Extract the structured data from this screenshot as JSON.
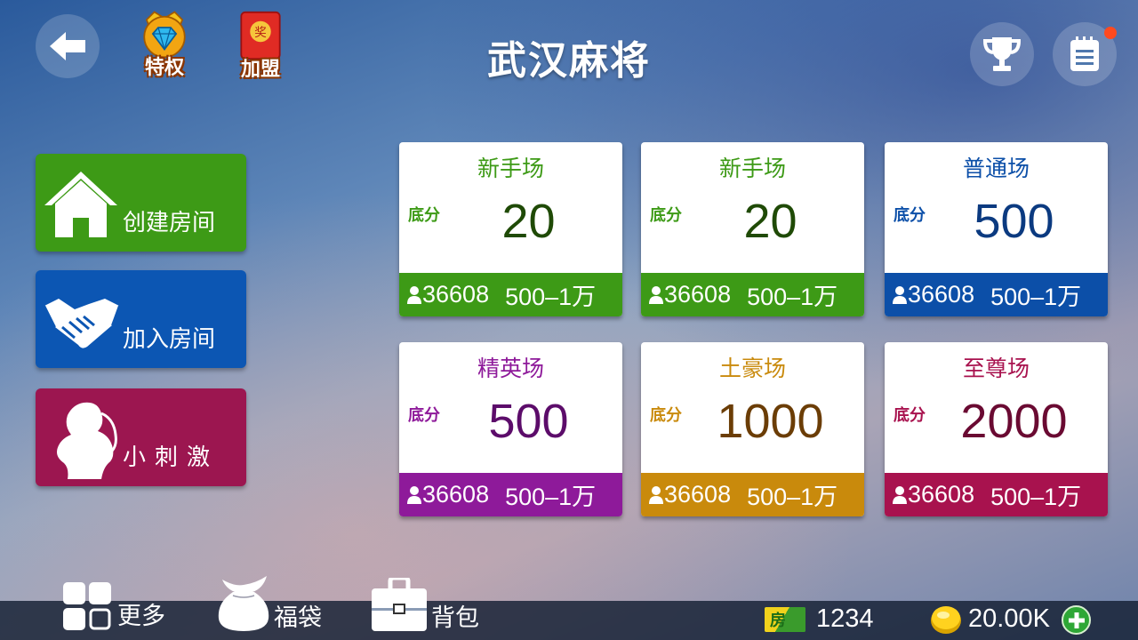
{
  "header": {
    "title": "武汉麻将",
    "vip_label": "特权",
    "join_label": "加盟",
    "join_badge": "奖"
  },
  "side_buttons": {
    "create": "创建房间",
    "join": "加入房间",
    "thrill": "小刺激"
  },
  "rooms": [
    {
      "name": "新手场",
      "base_label": "底分",
      "value": "20",
      "players": "36608",
      "range": "500–1万",
      "accent": "#3d9a16",
      "value_color": "#1f4a06"
    },
    {
      "name": "新手场",
      "base_label": "底分",
      "value": "20",
      "players": "36608",
      "range": "500–1万",
      "accent": "#3d9a16",
      "value_color": "#1f4a06"
    },
    {
      "name": "普通场",
      "base_label": "底分",
      "value": "500",
      "players": "36608",
      "range": "500–1万",
      "accent": "#0c4fa8",
      "value_color": "#0b3a80"
    },
    {
      "name": "精英场",
      "base_label": "底分",
      "value": "500",
      "players": "36608",
      "range": "500–1万",
      "accent": "#8e1a9a",
      "value_color": "#5c0c6a"
    },
    {
      "name": "土豪场",
      "base_label": "底分",
      "value": "1000",
      "players": "36608",
      "range": "500–1万",
      "accent": "#c98a0c",
      "value_color": "#6b3d06"
    },
    {
      "name": "至尊场",
      "base_label": "底分",
      "value": "2000",
      "players": "36608",
      "range": "500–1万",
      "accent": "#a8124e",
      "value_color": "#6a0a32"
    }
  ],
  "bottom": {
    "more": "更多",
    "bag": "福袋",
    "pack": "背包",
    "room_card_label": "房",
    "room_cards": "1234",
    "gold": "20.00K"
  }
}
